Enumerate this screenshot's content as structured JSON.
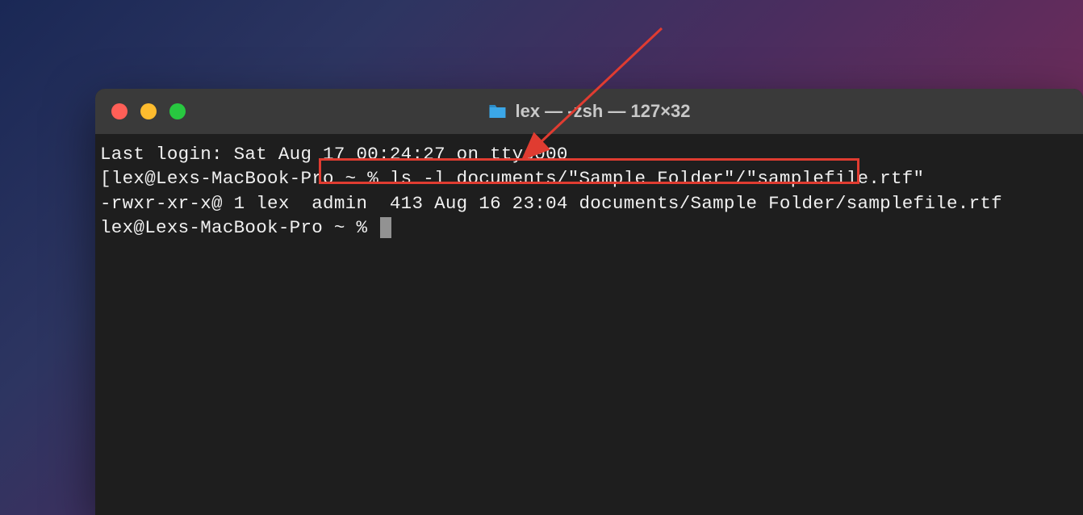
{
  "window": {
    "title": "lex — -zsh — 127×32"
  },
  "terminal": {
    "line1": "Last login: Sat Aug 17 00:24:27 on ttys000",
    "line2_prompt": "[lex@Lexs-MacBook-Pro ~ % ",
    "line2_command": "ls -l documents/\"Sample Folder\"/\"samplefile.rtf\"",
    "line3": "-rwxr-xr-x@ 1 lex  admin  413 Aug 16 23:04 documents/Sample Folder/samplefile.rtf",
    "line4_prompt": "lex@Lexs-MacBook-Pro ~ % "
  }
}
